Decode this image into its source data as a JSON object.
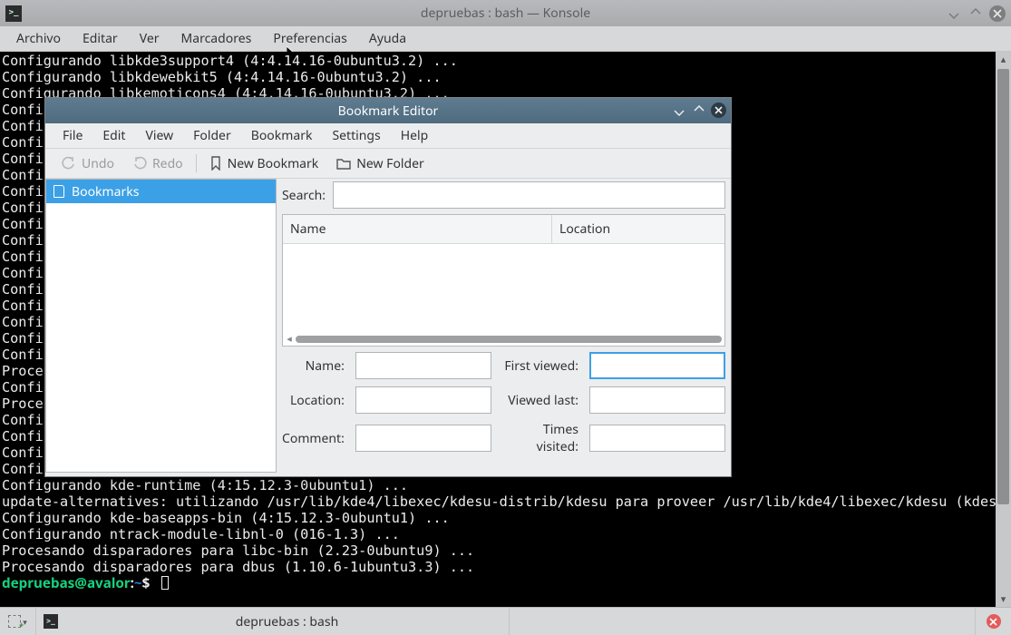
{
  "konsole": {
    "title": "depruebas : bash — Konsole",
    "menu": [
      "Archivo",
      "Editar",
      "Ver",
      "Marcadores",
      "Preferencias",
      "Ayuda"
    ],
    "tab_label": "depruebas : bash"
  },
  "terminal": {
    "lines": [
      "Configurando libkde3support4 (4:4.14.16-0ubuntu3.2) ...",
      "Configurando libkdewebkit5 (4:4.14.16-0ubuntu3.2) ...",
      "Configurando libkemoticons4 (4:4.14.16-0ubuntu3.2) ...",
      "Confi",
      "Confi",
      "Confi",
      "Confi",
      "Confi",
      "Confi",
      "Confi",
      "Confi",
      "Confi",
      "Confi",
      "Confi",
      "Confi",
      "Confi",
      "Confi",
      "Confi",
      "Confi",
      "Proce",
      "Confi",
      "Proce",
      "Confi",
      "Confi",
      "Confi",
      "Confi",
      "Configurando kde-runtime (4:15.12.3-0ubuntu1) ...",
      "update-alternatives: utilizando /usr/lib/kde4/libexec/kdesu-distrib/kdesu para proveer /usr/lib/kde4/libexec/kdesu (kdes",
      "Configurando kde-baseapps-bin (4:15.12.3-0ubuntu1) ...",
      "Configurando ntrack-module-libnl-0 (016-1.3) ...",
      "Procesando disparadores para libc-bin (2.23-0ubuntu9) ...",
      "Procesando disparadores para dbus (1.10.6-1ubuntu3.3) ..."
    ],
    "prompt": {
      "user": "depruebas@avalor",
      "sep": ":",
      "path": "~",
      "end": "$"
    }
  },
  "dialog": {
    "title": "Bookmark Editor",
    "menu": [
      "File",
      "Edit",
      "View",
      "Folder",
      "Bookmark",
      "Settings",
      "Help"
    ],
    "toolbar": {
      "undo": "Undo",
      "redo": "Redo",
      "new_bookmark": "New Bookmark",
      "new_folder": "New Folder"
    },
    "tree_root": "Bookmarks",
    "search_label": "Search:",
    "columns": {
      "name": "Name",
      "location": "Location"
    },
    "form": {
      "name": "Name:",
      "location": "Location:",
      "comment": "Comment:",
      "first_viewed": "First viewed:",
      "viewed_last": "Viewed last:",
      "times_visited": "Times visited:"
    }
  }
}
